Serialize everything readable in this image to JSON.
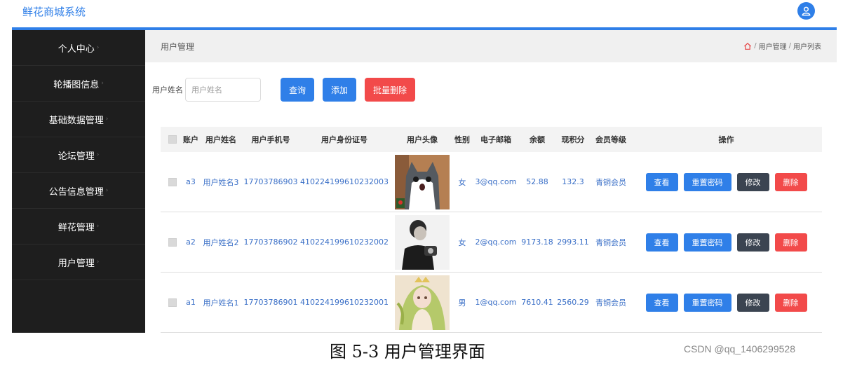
{
  "app": {
    "title": "鲜花商城系统"
  },
  "colors": {
    "accent": "#2f7fe8",
    "danger": "#f24a4a",
    "dark_button": "#3b4451",
    "sidebar_bg": "#1e1e1e"
  },
  "sidebar": {
    "items": [
      {
        "label": "个人中心"
      },
      {
        "label": "轮播图信息"
      },
      {
        "label": "基础数据管理"
      },
      {
        "label": "论坛管理"
      },
      {
        "label": "公告信息管理"
      },
      {
        "label": "鲜花管理"
      },
      {
        "label": "用户管理"
      }
    ]
  },
  "header": {
    "title": "用户管理",
    "breadcrumb": [
      "用户管理",
      "用户列表"
    ],
    "separator": "/"
  },
  "search": {
    "label": "用户姓名",
    "placeholder": "用户姓名",
    "value": "",
    "query_label": "查询",
    "add_label": "添加",
    "batch_delete_label": "批量删除"
  },
  "table": {
    "columns": [
      "账户",
      "用户姓名",
      "用户手机号",
      "用户身份证号",
      "用户头像",
      "性别",
      "电子邮箱",
      "余额",
      "现积分",
      "会员等级",
      "操作"
    ],
    "actions": {
      "view": "查看",
      "reset_password": "重置密码",
      "edit": "修改",
      "delete": "删除"
    },
    "rows": [
      {
        "account": "a3",
        "name": "用户姓名3",
        "phone": "17703786903",
        "id_number": "410224199610232003",
        "avatar": "cat-photo",
        "gender": "女",
        "email": "3@qq.com",
        "balance": "52.88",
        "points": "132.3",
        "level": "青铜会员"
      },
      {
        "account": "a2",
        "name": "用户姓名2",
        "phone": "17703786902",
        "id_number": "410224199610232002",
        "avatar": "man-photo",
        "gender": "女",
        "email": "2@qq.com",
        "balance": "9173.18",
        "points": "2993.11",
        "level": "青铜会员"
      },
      {
        "account": "a1",
        "name": "用户姓名1",
        "phone": "17703786901",
        "id_number": "410224199610232001",
        "avatar": "anime-girl-illustration",
        "gender": "男",
        "email": "1@qq.com",
        "balance": "7610.41",
        "points": "2560.29",
        "level": "青铜会员"
      }
    ]
  },
  "caption": "图 5-3 用户管理界面",
  "watermark": "CSDN @qq_1406299528"
}
